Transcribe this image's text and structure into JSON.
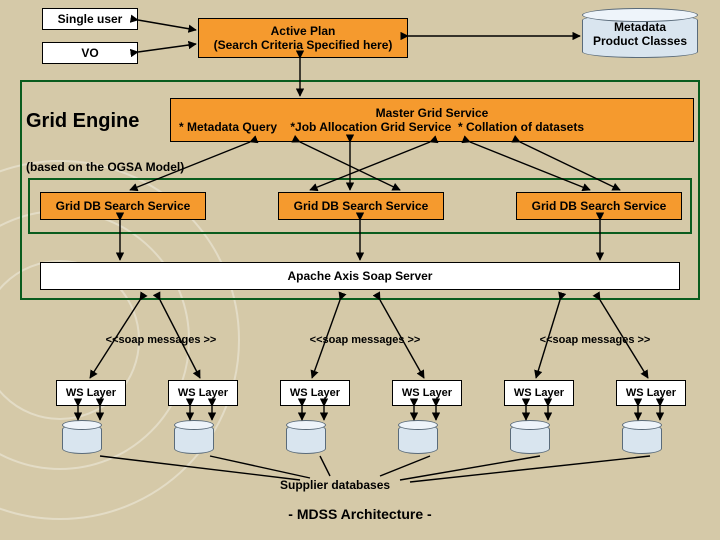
{
  "top": {
    "single_user": "Single user",
    "vo": "VO",
    "active_plan_l1": "Active Plan",
    "active_plan_l2": "(Search Criteria Specified here)",
    "metadata_l1": "Metadata",
    "metadata_l2": "Product Classes"
  },
  "grid_engine": "Grid Engine",
  "ogsa_note": "(based on the OGSA Model)",
  "master": {
    "title": "Master Grid Service",
    "items": "* Metadata Query    *Job Allocation Grid Service  * Collation of datasets"
  },
  "search_svc": "Grid DB Search Service",
  "axis": "Apache Axis Soap Server",
  "soap_msg": "<<soap messages >>",
  "ws": "WS Layer",
  "supplier": "Supplier databases",
  "footer": "- MDSS Architecture -"
}
